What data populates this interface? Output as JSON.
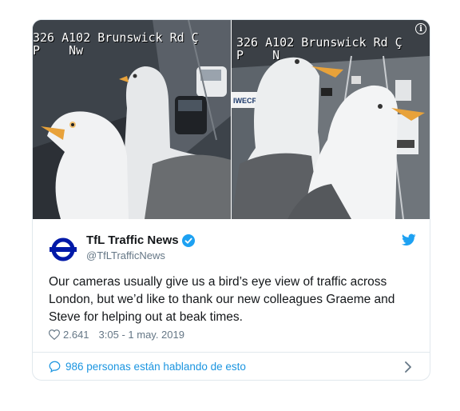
{
  "media": {
    "left": {
      "cam_line1": "326 A102 Brunswick Rd Ç",
      "cam_line2": "P    Nw"
    },
    "right": {
      "cam_line1": "326 A102 Brunswick Rd Ç",
      "cam_line2": "P    N",
      "sign_text": "IWECROSS",
      "info_label": "i"
    }
  },
  "author": {
    "name": "TfL Traffic News",
    "handle": "@TfLTrafficNews"
  },
  "tweet": {
    "text": "Our cameras usually give us a bird’s eye view of traffic across London, but we’d like to thank our new colleagues Graeme and Steve for helping out at beak times.",
    "likes": "2.641",
    "timestamp": "3:05 - 1 may. 2019"
  },
  "footer": {
    "talking_label": "986 personas están hablando de esto"
  },
  "colors": {
    "accent": "#1b95e0",
    "tfl_red": "#dc241f",
    "tfl_blue": "#0019a8",
    "verified": "#1da1f2"
  },
  "icons": [
    "info-icon",
    "tfl-roundel-icon",
    "verified-badge-icon",
    "twitter-bird-icon",
    "heart-icon",
    "speech-bubble-icon",
    "chevron-right-icon"
  ]
}
